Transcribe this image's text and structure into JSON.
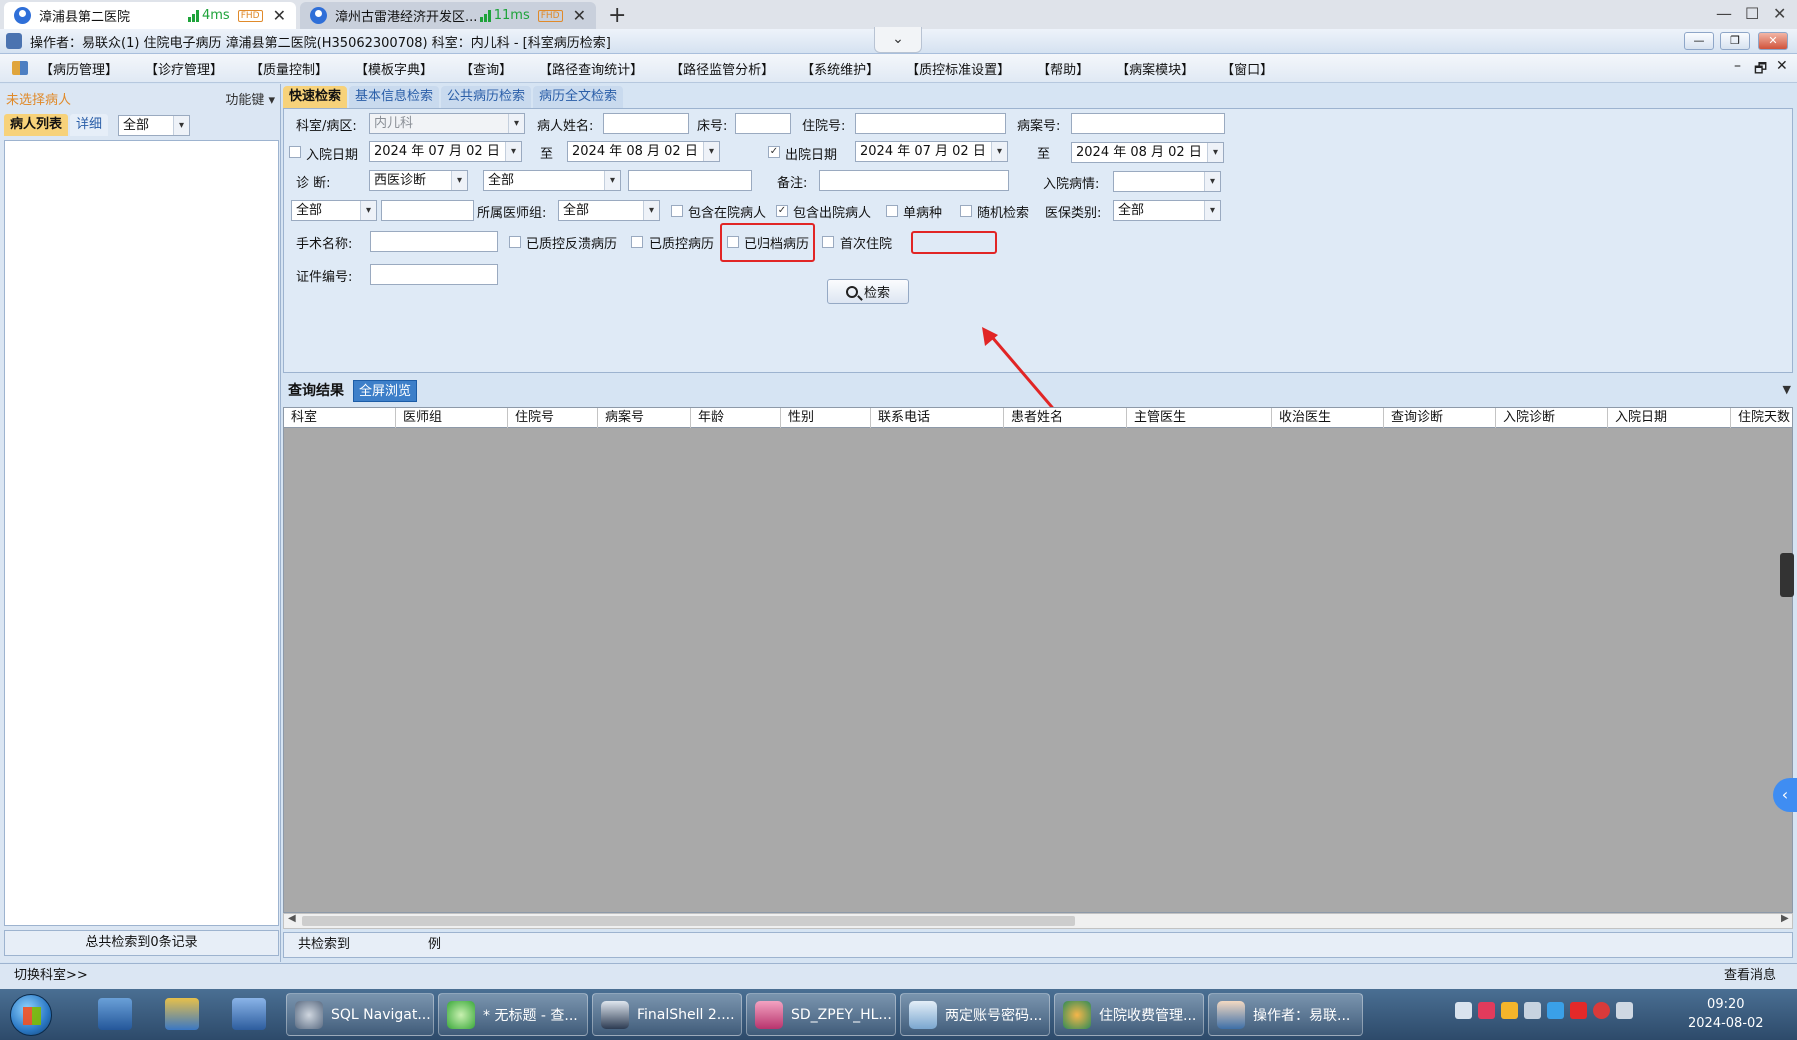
{
  "browser": {
    "tabs": [
      {
        "title": "漳浦县第二医院",
        "latency": "4ms",
        "badge": "FHD"
      },
      {
        "title": "漳州古雷港经济开发区...",
        "latency": "11ms",
        "badge": "FHD"
      }
    ],
    "new_tab": "+",
    "controls": {
      "minimize": "—",
      "maximize": "☐",
      "close": "✕"
    }
  },
  "app": {
    "title": "操作者：易联众(1) 住院电子病历  漳浦县第二医院(H35062300708)  科室：内儿科 - [科室病历检索]",
    "collapse_glyph": "⌄",
    "window_controls": {
      "minimize": "—",
      "restore": "❐",
      "close": "✕"
    }
  },
  "menu": {
    "items": [
      "【病历管理】",
      "【诊疗管理】",
      "【质量控制】",
      "【模板字典】",
      "【查询】",
      "【路径查询统计】",
      "【路径监管分析】",
      "【系统维护】",
      "【质控标准设置】",
      "【帮助】",
      "【病案模块】",
      "【窗口】"
    ],
    "mdi_controls": {
      "minimize": "–",
      "restore": "🗗",
      "close": "✕"
    }
  },
  "left_panel": {
    "status": "未选择病人",
    "function_key": "功能键 ▾",
    "tabs": [
      "病人列表",
      "详细"
    ],
    "filter": "全部",
    "footer": "总共检索到0条记录"
  },
  "search": {
    "tabs": [
      "快速检索",
      "基本信息检索",
      "公共病历检索",
      "病历全文检索"
    ],
    "labels": {
      "dept": "科室/病区:",
      "patient_name": "病人姓名:",
      "bed": "床号:",
      "inpatient_no": "住院号:",
      "case_no": "病案号:",
      "admit_date": "入院日期",
      "to1": "至",
      "discharge_date": "出院日期",
      "to2": "至",
      "diagnosis": "诊      断:",
      "remark": "备注:",
      "admit_condition": "入院病情:",
      "doctor_group": "所属医师组:",
      "include_inpatients": "包含在院病人",
      "include_discharged": "包含出院病人",
      "single_disease": "单病种",
      "random_search": "随机检索",
      "insurance_type": "医保类别:",
      "surgery_name": "手术名称:",
      "qc_feedback": "已质控反溃病历",
      "qc_done": "已质控病历",
      "archived": "已归档病历",
      "first_admission": "首次住院",
      "id_no": "证件编号:"
    },
    "values": {
      "dept": "内儿科",
      "admit_from": "2024 年 07 月 02 日",
      "admit_to": "2024 年 08 月 02 日",
      "discharge_from": "2024 年 07 月 02 日",
      "discharge_to": "2024 年 08 月 02 日",
      "diagnosis_type": "西医诊断",
      "diagnosis_scope": "全部",
      "row4_select": "全部",
      "doctor_group": "全部",
      "insurance_type": "全部"
    },
    "checks": {
      "admit_date": false,
      "discharge_date": true,
      "include_inpatients": false,
      "include_discharged": true,
      "single_disease": false,
      "random_search": false,
      "qc_feedback": false,
      "qc_done": false,
      "archived": false,
      "first_admission": false
    },
    "button": "检索",
    "annotation_color": "#e12525"
  },
  "results": {
    "tabs": [
      "查询结果",
      "全屏浏览"
    ],
    "columns": [
      "科室",
      "医师组",
      "住院号",
      "病案号",
      "年龄",
      "性别",
      "联系电话",
      "患者姓名",
      "主管医生",
      "收治医生",
      "查询诊断",
      "入院诊断",
      "入院日期",
      "住院天数"
    ],
    "footer_label": "共检索到",
    "footer_unit": "例"
  },
  "status_bar": {
    "left": "切换科室>>",
    "right": "查看消息>>"
  },
  "taskbar": {
    "buttons": [
      "SQL Navigat...",
      "* 无标题 - 查...",
      "FinalShell 2....",
      "SD_ZPEY_HL...",
      "两定账号密码...",
      "住院收费管理...",
      "操作者：易联..."
    ],
    "time": "09:20",
    "date": "2024-08-02"
  }
}
